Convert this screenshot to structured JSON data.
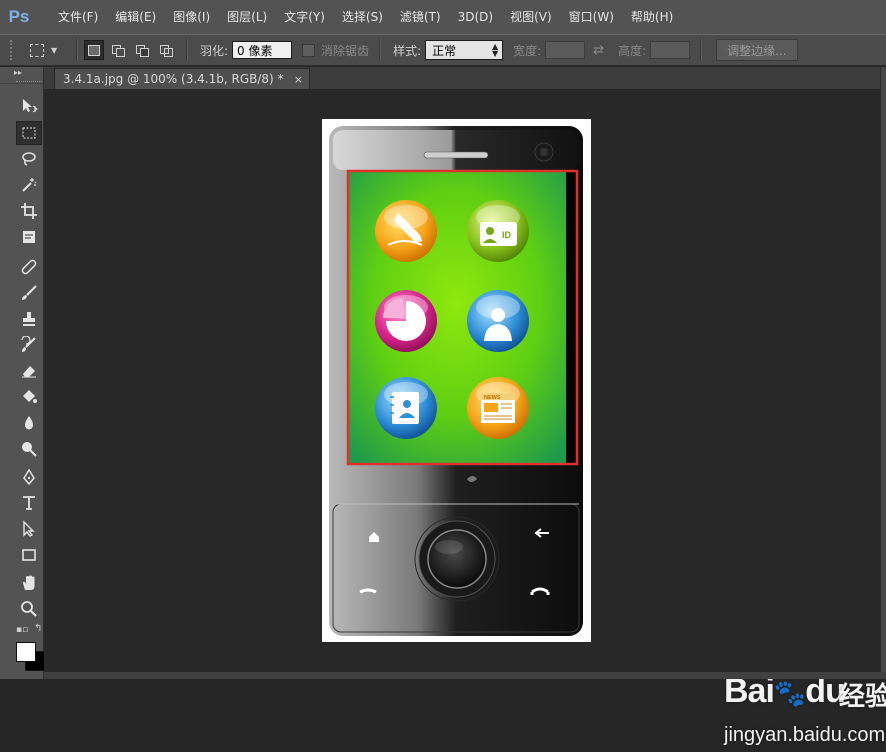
{
  "app": {
    "logo": "Ps"
  },
  "menu": [
    "文件(F)",
    "编辑(E)",
    "图像(I)",
    "图层(L)",
    "文字(Y)",
    "选择(S)",
    "滤镜(T)",
    "3D(D)",
    "视图(V)",
    "窗口(W)",
    "帮助(H)"
  ],
  "options": {
    "feather_label": "羽化:",
    "feather_value": "0 像素",
    "antialias_label": "消除锯齿",
    "style_label": "样式:",
    "style_value": "正常",
    "width_label": "宽度:",
    "height_label": "高度:",
    "refine_edge": "调整边缘..."
  },
  "document": {
    "tab_title": "3.4.1a.jpg @ 100% (3.4.1b, RGB/8) *",
    "close": "×"
  },
  "icons": {
    "app_icons": [
      {
        "name": "pen-app-icon",
        "color": "#f7a51a"
      },
      {
        "name": "id-card-app-icon",
        "color": "#8bc21c",
        "text": "ID"
      },
      {
        "name": "pie-app-icon",
        "color": "#d9268c"
      },
      {
        "name": "user-app-icon",
        "color": "#2f8fd8"
      },
      {
        "name": "contacts-app-icon",
        "color": "#2f8fd8"
      },
      {
        "name": "news-app-icon",
        "color": "#f7a51a",
        "text": "NEWS"
      }
    ]
  },
  "colors": {
    "selection": "#e0302e",
    "screen": "#5fd10e",
    "foreground": "#ffffff",
    "background": "#000000"
  },
  "watermark": {
    "logo": "Bai",
    "logo_du": "du",
    "brand": "经验",
    "url": "jingyan.baidu.com"
  }
}
